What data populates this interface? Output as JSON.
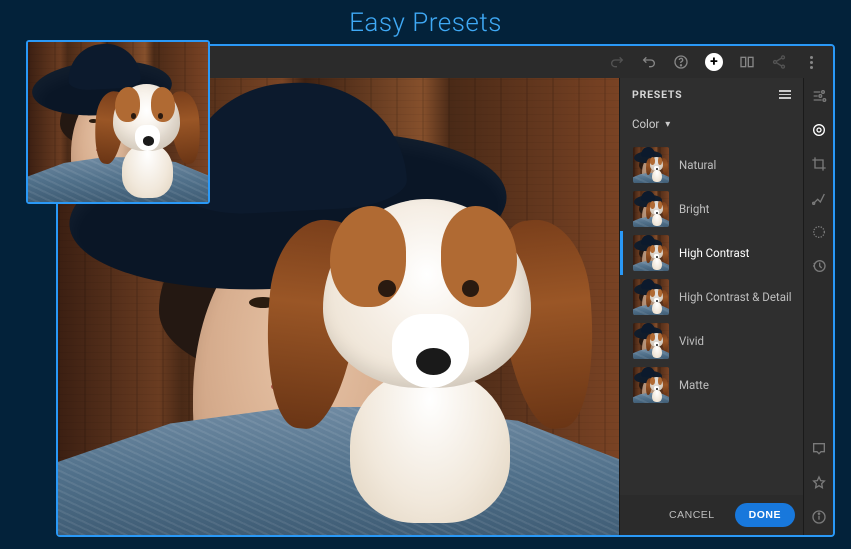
{
  "page": {
    "title": "Easy Presets"
  },
  "panel": {
    "heading": "PRESETS",
    "category_label": "Color",
    "cancel_label": "CANCEL",
    "done_label": "DONE"
  },
  "presets": {
    "active_index": 2,
    "items": [
      {
        "label": "Natural"
      },
      {
        "label": "Bright"
      },
      {
        "label": "High Contrast"
      },
      {
        "label": "High Contrast & Detail"
      },
      {
        "label": "Vivid"
      },
      {
        "label": "Matte"
      }
    ]
  },
  "side_icons": [
    {
      "name": "sliders-icon"
    },
    {
      "name": "presets-icon"
    },
    {
      "name": "crop-icon"
    },
    {
      "name": "healing-icon"
    },
    {
      "name": "radial-icon"
    },
    {
      "name": "history-icon"
    }
  ],
  "side_icons_bottom": [
    {
      "name": "comment-icon"
    },
    {
      "name": "star-icon"
    },
    {
      "name": "info-icon"
    }
  ]
}
